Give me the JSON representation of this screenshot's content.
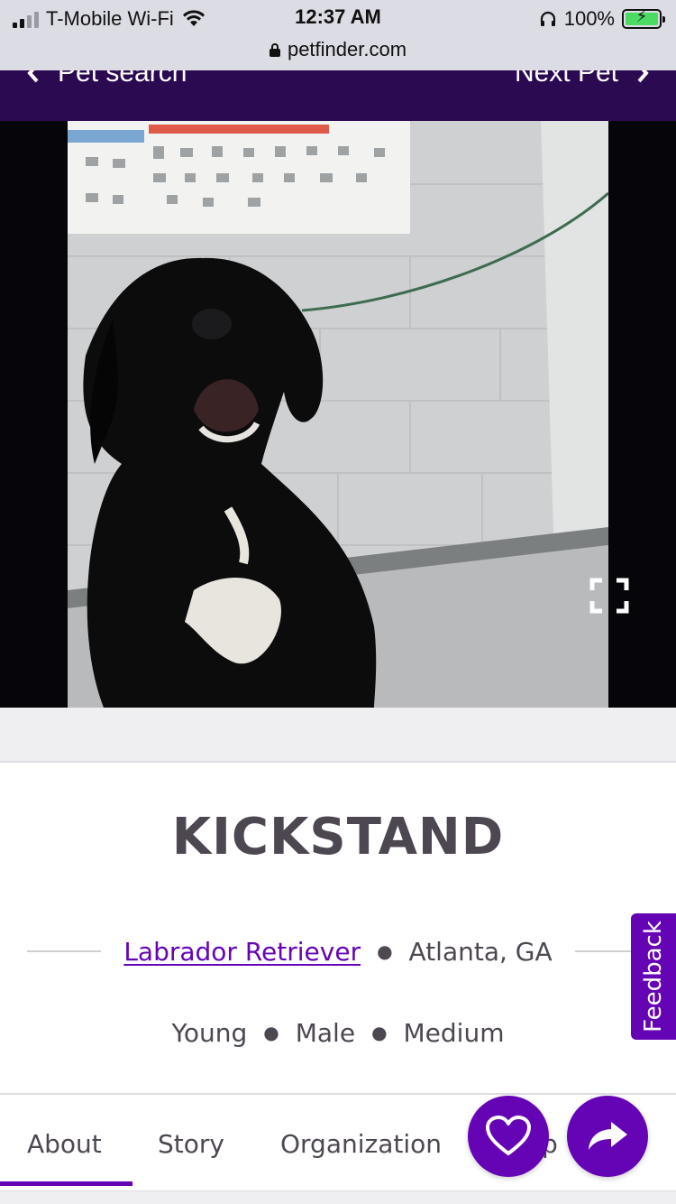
{
  "status_bar": {
    "carrier": "T-Mobile Wi-Fi",
    "time": "12:37 AM",
    "battery": "100%",
    "url": "petfinder.com"
  },
  "nav": {
    "prev_label": "Pet search",
    "next_label": "Next Pet"
  },
  "pet": {
    "name": "KICKSTAND",
    "breed": "Labrador Retriever",
    "location": "Atlanta, GA",
    "age": "Young",
    "sex": "Male",
    "size": "Medium"
  },
  "feedback_label": "Feedback",
  "tabs": [
    {
      "label": "About"
    },
    {
      "label": "Story"
    },
    {
      "label": "Organization"
    },
    {
      "label": "Help"
    }
  ],
  "colors": {
    "brand_purple": "#6504b5",
    "nav_purple": "#2c0a52"
  },
  "icons": {
    "favorite": "heart-icon",
    "share": "share-arrow-icon",
    "expand": "fullscreen-icon"
  }
}
